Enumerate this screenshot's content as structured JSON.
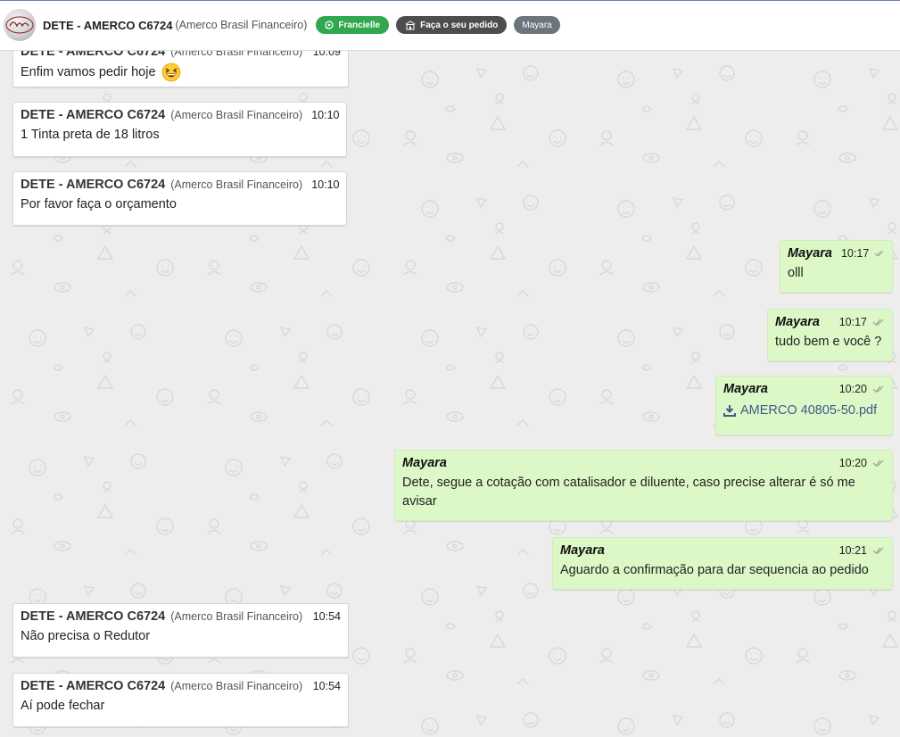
{
  "header": {
    "title": "DETE - AMERCO C6724",
    "subtitle": "(Amerco Brasil Financeiro)",
    "tags": {
      "agent": "Francielle",
      "order": "Faça o seu pedido",
      "user": "Mayara"
    }
  },
  "messages": [
    {
      "dir": "in",
      "name": "DETE - AMERCO C6724",
      "org": "(Amerco Brasil Financeiro)",
      "time": "10:09",
      "text": "Enfim vamos pedir hoje"
    },
    {
      "dir": "in",
      "name": "DETE - AMERCO C6724",
      "org": "(Amerco Brasil Financeiro)",
      "time": "10:10",
      "text": "1 Tinta preta de 18 litros"
    },
    {
      "dir": "in",
      "name": "DETE - AMERCO C6724",
      "org": "(Amerco Brasil Financeiro)",
      "time": "10:10",
      "text": "Por favor faça o orçamento"
    },
    {
      "dir": "out",
      "name": "Mayara",
      "time": "10:17",
      "text": "olll"
    },
    {
      "dir": "out",
      "name": "Mayara",
      "time": "10:17",
      "text": "tudo bem e você ?"
    },
    {
      "dir": "out",
      "name": "Mayara",
      "time": "10:20",
      "attachment": "AMERCO 40805-50.pdf"
    },
    {
      "dir": "out",
      "name": "Mayara",
      "time": "10:20",
      "text": "Dete, segue a cotação com catalisador e diluente, caso precise alterar é só me avisar"
    },
    {
      "dir": "out",
      "name": "Mayara",
      "time": "10:21",
      "text": "Aguardo a confirmação para dar sequencia ao pedido"
    },
    {
      "dir": "in",
      "name": "DETE - AMERCO C6724",
      "org": "(Amerco Brasil Financeiro)",
      "time": "10:54",
      "text": "Não precisa o Redutor"
    },
    {
      "dir": "in",
      "name": "DETE - AMERCO C6724",
      "org": "(Amerco Brasil Financeiro)",
      "time": "10:54",
      "text": "Aí pode fechar"
    }
  ],
  "colors": {
    "incoming_bubble": "#ffffff",
    "outgoing_bubble": "#dcf8c6",
    "agent_tag": "#2fa84f",
    "order_tag": "#4d4d4d",
    "user_tag": "#6c757d",
    "attachment_link": "#3d5a8a"
  },
  "icons": {
    "agent_tag": "whatsapp-icon",
    "order_tag": "store-icon",
    "attachment": "download-icon",
    "read_status": "double-check-icon",
    "emoji": "grinning-squinting-face-emoji"
  }
}
